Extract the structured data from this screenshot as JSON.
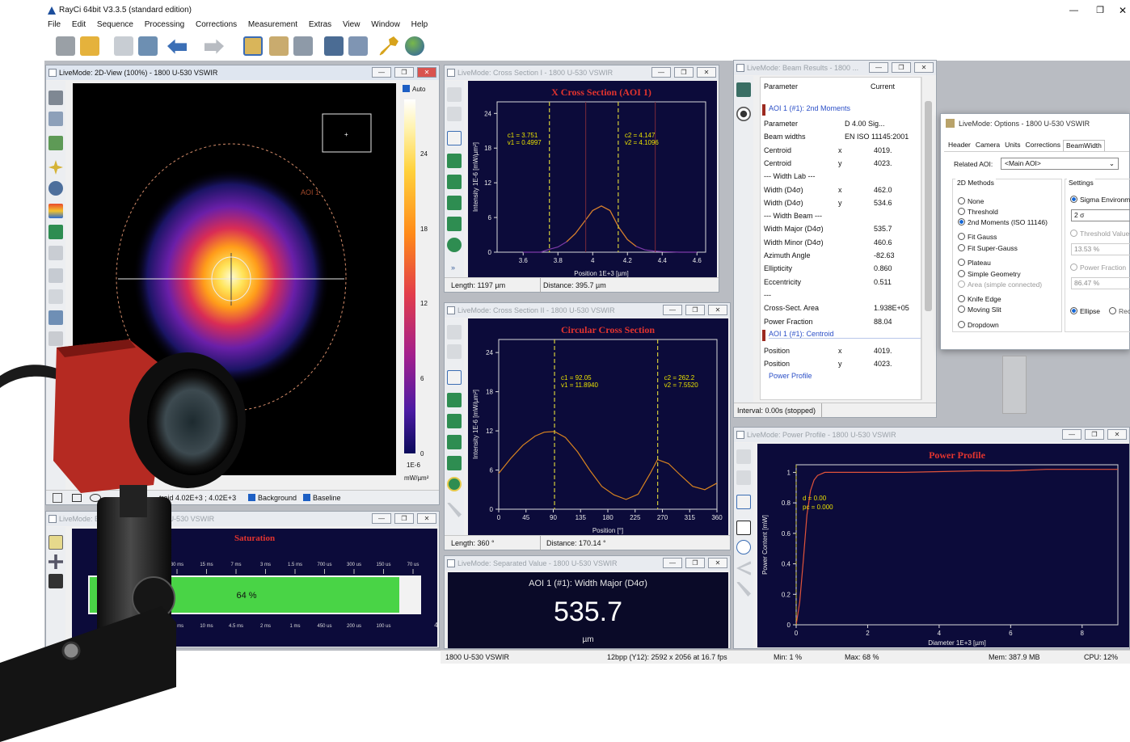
{
  "app": {
    "title": "RayCi 64bit V3.3.5 (standard edition)",
    "window_controls": [
      "—",
      "❐",
      "✕"
    ],
    "menu": [
      "File",
      "Edit",
      "Sequence",
      "Processing",
      "Corrections",
      "Measurement",
      "Extras",
      "View",
      "Window",
      "Help"
    ]
  },
  "toolbar_icons": [
    "camera-icon",
    "open-folder-icon",
    "save-icon",
    "image-icon",
    "undo-icon",
    "redo-icon",
    "measurement-icon",
    "document-icon",
    "settings-icon",
    "monitor-icon",
    "windows-icon",
    "key-icon",
    "globe-icon"
  ],
  "view2d": {
    "title": "LiveMode: 2D-View (100%) - 1800 U-530 VSWIR",
    "auto_label": "Auto",
    "aoi_label": "AOI 1",
    "scale_ticks": [
      "24",
      "18",
      "12",
      "6",
      "0"
    ],
    "scale_unit_top": "1E-6",
    "scale_unit_bottom": "mW/µm²",
    "status_text": "troid 4.02E+3 ;  4.02E+3",
    "background_label": "Background",
    "baseline_label": "Baseline"
  },
  "dynamic": {
    "title": "LiveMode: Beam Dynamic - 1800 U-530 VSWIR",
    "heading": "Saturation",
    "top_ticks": [
      "30 ms",
      "15 ms",
      "7 ms",
      "3 ms",
      "1.5 ms",
      "700 us",
      "300 us",
      "150 us",
      "70 us"
    ],
    "bottom_ticks": [
      "20 ms",
      "10 ms",
      "4.5 ms",
      "2 ms",
      "1 ms",
      "450 us",
      "200 us",
      "100 us",
      "45 us"
    ],
    "bar_label": "64 %",
    "saturation": 0.93
  },
  "cs1": {
    "title": "LiveMode: Cross Section I - 1800 U-530 VSWIR",
    "heading": "X Cross Section (AOI 1)",
    "ylabel": "Intensity 1E-6 [mW/µm²]",
    "xlabel": "Position 1E+3 [µm]",
    "c1": "c1 = 3.751",
    "v1": "v1 = 0.4997",
    "c2": "c2 = 4.147",
    "v2": "v2 = 4.1096",
    "status_length": "Length:  1197 µm",
    "status_distance": "Distance:  395.7 µm",
    "more_label": "»"
  },
  "cs2": {
    "title": "LiveMode: Cross Section II - 1800 U-530 VSWIR",
    "heading": "Circular Cross Section",
    "ylabel": "Intensity 1E-6 [mW/µm²]",
    "xlabel": "Position [°]",
    "c1": "c1 = 92.05",
    "v1": "v1 = 11.8940",
    "c2": "c2 = 262.2",
    "v2": "v2 = 7.5520",
    "status_length": "Length:  360 °",
    "status_distance": "Distance:  170.14 °"
  },
  "separated": {
    "title": "LiveMode: Separated Value - 1800 U-530 VSWIR",
    "label": "AOI 1 (#1): Width Major (D4σ)",
    "value": "535.7",
    "unit": "µm"
  },
  "results": {
    "title": "LiveMode: Beam Results - 1800 ...",
    "col_param": "Parameter",
    "col_current": "Current",
    "section1": "AOI 1 (#1): 2nd Moments",
    "rows": [
      {
        "p": "Parameter",
        "c": "",
        "v": "D 4.00 Sig..."
      },
      {
        "p": "Beam widths",
        "c": "",
        "v": "EN ISO 11145:2001"
      },
      {
        "p": "Centroid",
        "c": "x",
        "v": "4019."
      },
      {
        "p": "Centroid",
        "c": "y",
        "v": "4023."
      },
      {
        "p": "--- Width Lab ---",
        "c": "",
        "v": ""
      },
      {
        "p": "Width (D4σ)",
        "c": "x",
        "v": "462.0"
      },
      {
        "p": "Width (D4σ)",
        "c": "y",
        "v": "534.6"
      },
      {
        "p": "--- Width Beam ---",
        "c": "",
        "v": ""
      },
      {
        "p": "Width Major (D4σ)",
        "c": "",
        "v": "535.7"
      },
      {
        "p": "Width Minor (D4σ)",
        "c": "",
        "v": "460.6"
      },
      {
        "p": "Azimuth Angle",
        "c": "",
        "v": "-82.63"
      },
      {
        "p": "Ellipticity",
        "c": "",
        "v": "0.860"
      },
      {
        "p": "Eccentricity",
        "c": "",
        "v": "0.511"
      },
      {
        "p": "---",
        "c": "",
        "v": ""
      },
      {
        "p": "Cross-Sect. Area",
        "c": "",
        "v": "1.938E+05"
      },
      {
        "p": "Power Fraction",
        "c": "",
        "v": "88.04"
      }
    ],
    "section2": "AOI 1 (#1): Centroid",
    "rows2": [
      {
        "p": "Position",
        "c": "x",
        "v": "4019."
      },
      {
        "p": "Position",
        "c": "y",
        "v": "4023."
      }
    ],
    "section3": "Power Profile",
    "status": "Interval: 0.00s (stopped)"
  },
  "options": {
    "title": "LiveMode: Options - 1800 U-530 VSWIR",
    "tabs": [
      "Header",
      "Camera",
      "Units",
      "Corrections",
      "BeamWidth"
    ],
    "related_aoi_label": "Related AOI:",
    "related_aoi_value": "<Main AOI>",
    "methods_label": "2D Methods",
    "methods": [
      {
        "label": "None",
        "on": false,
        "dis": false
      },
      {
        "label": "Threshold",
        "on": false,
        "dis": false
      },
      {
        "label": "2nd Moments (ISO 11146)",
        "on": true,
        "dis": false
      },
      {
        "label": "Fit Gauss",
        "on": false,
        "dis": false
      },
      {
        "label": "Fit Super-Gauss",
        "on": false,
        "dis": false
      },
      {
        "label": "Plateau",
        "on": false,
        "dis": false
      },
      {
        "label": "Simple Geometry",
        "on": false,
        "dis": false
      },
      {
        "label": "Area (simple connected)",
        "on": false,
        "dis": true
      },
      {
        "label": "Knife Edge",
        "on": false,
        "dis": false
      },
      {
        "label": "Moving Slit",
        "on": false,
        "dis": false
      },
      {
        "label": "Dropdown",
        "on": false,
        "dis": false
      }
    ],
    "settings_label": "Settings",
    "sigma_label": "Sigma Environme",
    "sigma_value": "2 σ",
    "threshold_label": "Threshold Value",
    "threshold_value": "13.53 %",
    "power_fraction_label": "Power Fraction",
    "power_fraction_value": "86.47 %",
    "ellipse_label": "Ellipse",
    "rect_label": "Rec"
  },
  "power": {
    "title": "LiveMode: Power Profile - 1800 U-530 VSWIR",
    "heading": "Power Profile",
    "ylabel": "Power Content [mW]",
    "xlabel": "Diameter 1E+3 [µm]",
    "d": "d = 0.00",
    "pc": "pc = 0.000"
  },
  "bottom": {
    "camera": "1800 U-530 VSWIR",
    "format": "12bpp (Y12): 2592 x 2056 at 16.7 fps",
    "min": "Min:  1 %",
    "max": "Max:  68 %",
    "mem": "Mem: 387.9 MB",
    "cpu": "CPU: 12%"
  },
  "colors": {
    "plot_bg": "#0c0b3a",
    "curve": "#d8831f",
    "cursor": "#d4cc3a",
    "title_red": "#e3342f"
  },
  "chart_data": [
    {
      "type": "line",
      "title": "X Cross Section (AOI 1)",
      "xlabel": "Position 1E+3 [µm]",
      "ylabel": "Intensity 1E-6 [mW/µm²]",
      "xlim": [
        3.45,
        4.65
      ],
      "ylim": [
        0,
        26
      ],
      "x_ticks": [
        3.6,
        3.8,
        4.0,
        4.2,
        4.4,
        4.6
      ],
      "y_ticks": [
        0,
        6,
        12,
        18,
        24
      ],
      "series": [
        {
          "x": [
            3.6,
            3.7,
            3.75,
            3.8,
            3.85,
            3.9,
            3.95,
            4.0,
            4.05,
            4.1,
            4.15,
            4.2,
            4.25,
            4.3,
            4.35,
            4.4,
            4.5,
            4.6
          ],
          "y": [
            0,
            0,
            0.5,
            0.9,
            1.8,
            3.2,
            5.2,
            7.2,
            8.0,
            7.2,
            4.3,
            2.2,
            1.0,
            0.4,
            0.2,
            0.1,
            0,
            0
          ]
        }
      ]
    },
    {
      "type": "line",
      "title": "Circular Cross Section",
      "xlabel": "Position [°]",
      "ylabel": "Intensity 1E-6 [mW/µm²]",
      "xlim": [
        0,
        360
      ],
      "ylim": [
        0,
        26
      ],
      "x_ticks": [
        0,
        45,
        90,
        135,
        180,
        225,
        270,
        315,
        360
      ],
      "y_ticks": [
        0,
        6,
        12,
        18,
        24
      ],
      "series": [
        {
          "x": [
            0,
            20,
            40,
            60,
            75,
            92,
            110,
            130,
            150,
            170,
            190,
            210,
            230,
            250,
            262,
            280,
            300,
            320,
            340,
            360
          ],
          "y": [
            5.5,
            7.8,
            9.8,
            11.2,
            11.8,
            11.9,
            11.0,
            8.8,
            6.0,
            3.5,
            2.2,
            1.5,
            2.3,
            5.5,
            7.6,
            7.0,
            5.2,
            3.5,
            3.0,
            4.0
          ]
        }
      ]
    },
    {
      "type": "line",
      "title": "Power Profile",
      "xlabel": "Diameter 1E+3 [µm]",
      "ylabel": "Power Content [mW]",
      "xlim": [
        0,
        9
      ],
      "ylim": [
        0,
        1.05
      ],
      "x_ticks": [
        0,
        2,
        4,
        6,
        8
      ],
      "y_ticks": [
        0,
        0.2,
        0.4,
        0.6,
        0.8,
        1
      ],
      "series": [
        {
          "x": [
            0,
            0.1,
            0.2,
            0.3,
            0.4,
            0.5,
            0.6,
            0.7,
            0.8,
            1.0,
            1.5,
            2,
            3,
            4,
            5,
            6,
            7,
            8,
            9
          ],
          "y": [
            0,
            0.15,
            0.42,
            0.72,
            0.88,
            0.95,
            0.98,
            0.99,
            1.0,
            1.0,
            1.0,
            1.0,
            1.0,
            1.005,
            1.01,
            1.01,
            1.02,
            1.02,
            1.02
          ]
        }
      ]
    }
  ]
}
